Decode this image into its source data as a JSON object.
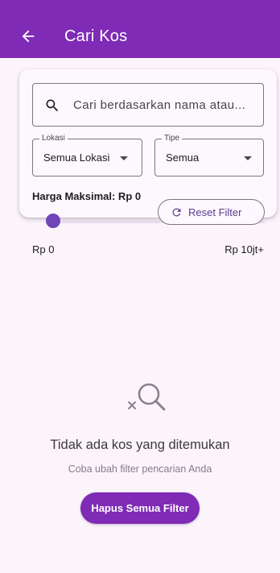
{
  "colors": {
    "primary": "#7f2bb5",
    "background": "#fbf5fb",
    "slider": "#6f45b8",
    "outline": "#7c7380"
  },
  "appbar": {
    "title": "Cari Kos",
    "back_icon": "arrow-left-icon"
  },
  "filters": {
    "search": {
      "placeholder": "Cari berdasarkan nama atau...",
      "icon": "search-icon"
    },
    "lokasi": {
      "label": "Lokasi",
      "value": "Semua Lokasi"
    },
    "tipe": {
      "label": "Tipe",
      "value": "Semua"
    },
    "harga": {
      "label": "Harga Maksimal: Rp 0",
      "min_label": "Rp 0",
      "max_label": "Rp 10jt+",
      "slider_value": 0
    },
    "reset_label": "Reset Filter",
    "reset_icon": "refresh-icon"
  },
  "empty_state": {
    "icon": "search-off-icon",
    "title": "Tidak ada kos yang ditemukan",
    "subtitle": "Coba ubah filter pencarian Anda",
    "button_label": "Hapus Semua Filter"
  }
}
